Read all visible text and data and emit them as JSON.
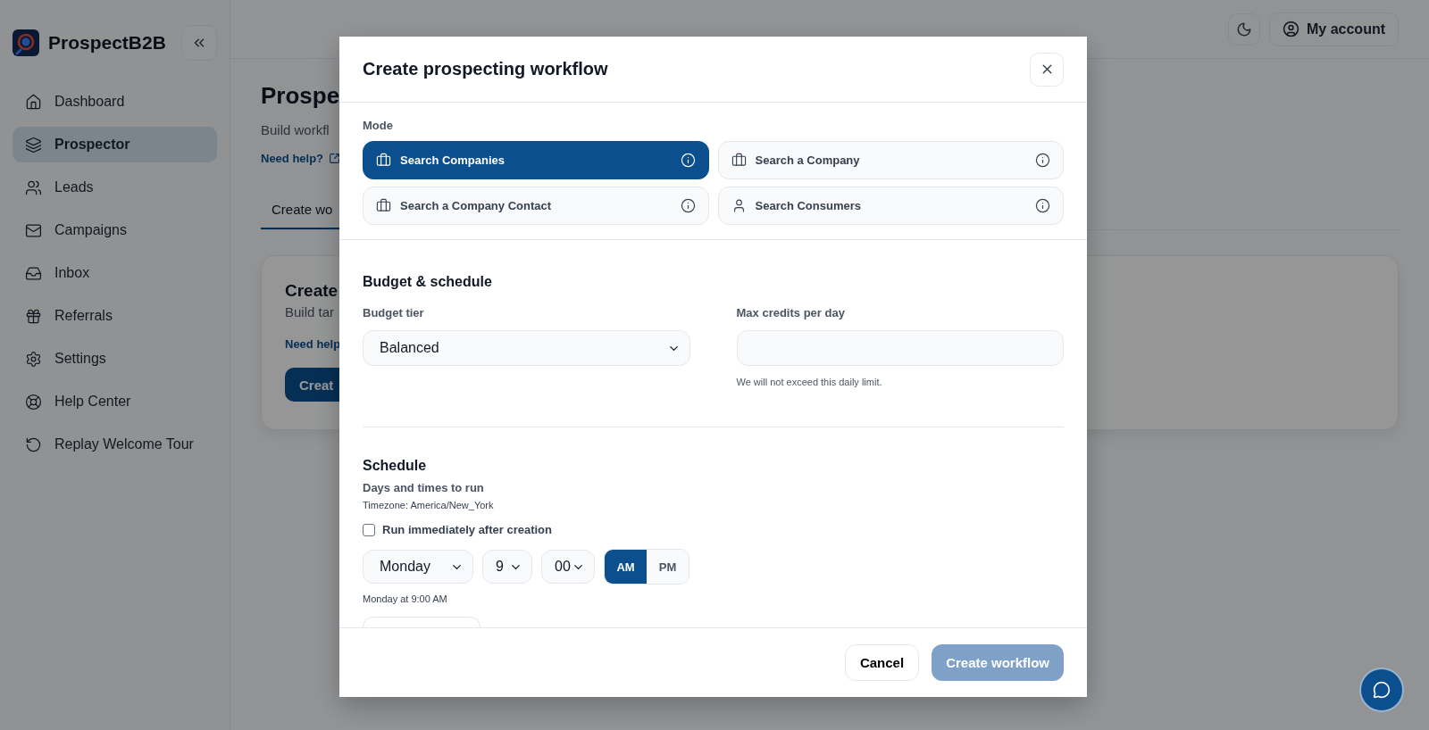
{
  "sidebar": {
    "brand": "ProspectB2B",
    "items": [
      {
        "label": "Dashboard",
        "selected": false
      },
      {
        "label": "Prospector",
        "selected": true
      },
      {
        "label": "Leads",
        "selected": false
      },
      {
        "label": "Campaigns",
        "selected": false
      },
      {
        "label": "Inbox",
        "selected": false
      },
      {
        "label": "Referrals",
        "selected": false
      },
      {
        "label": "Settings",
        "selected": false
      },
      {
        "label": "Help Center",
        "selected": false
      },
      {
        "label": "Replay Welcome Tour",
        "selected": false
      }
    ]
  },
  "header": {
    "account": "My account"
  },
  "page": {
    "title": "Prospe",
    "subtitle": "Build workfl",
    "help_link": "Need help?",
    "tabs": [
      {
        "label": "Create wo",
        "selected": true
      }
    ],
    "card": {
      "title": "Create",
      "text": "Build tar",
      "link": "Need help",
      "button": "Creat"
    }
  },
  "modal": {
    "title": "Create prospecting workflow",
    "mode_label": "Mode",
    "modes": [
      {
        "label": "Search Companies",
        "selected": true,
        "kind": "company"
      },
      {
        "label": "Search a Company",
        "selected": false,
        "kind": "company"
      },
      {
        "label": "Search a Company Contact",
        "selected": false,
        "kind": "company"
      },
      {
        "label": "Search Consumers",
        "selected": false,
        "kind": "person"
      }
    ],
    "budget": {
      "heading": "Budget & schedule",
      "tier_label": "Budget tier",
      "tier_value": "Balanced",
      "credits_label": "Max credits per day",
      "credits_hint": "We will not exceed this daily limit."
    },
    "schedule": {
      "heading": "Schedule",
      "subheading": "Days and times to run",
      "timezone": "Timezone: America/New_York",
      "run_immediately": {
        "label": "Run immediately after creation",
        "checked": false
      },
      "day": "Monday",
      "hour": "9",
      "minute": "00",
      "periods": [
        {
          "label": "AM",
          "selected": true
        },
        {
          "label": "PM",
          "selected": false
        }
      ],
      "summary": "Monday at 9:00 AM"
    },
    "footer": {
      "cancel": "Cancel",
      "submit": {
        "label": "Create workflow",
        "disabled": true
      }
    }
  }
}
